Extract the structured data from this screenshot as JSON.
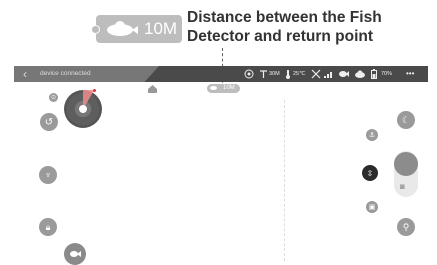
{
  "callout": {
    "badge_value": "10M",
    "text": "Distance between the Fish Detector and return point"
  },
  "topbar": {
    "back_icon": "‹",
    "connection_status": "device connected",
    "depth": "30M",
    "temperature": "25℃",
    "battery": "70%",
    "more": "•••"
  },
  "map": {
    "return_distance": "10M"
  },
  "icons": {
    "gps": "gps-icon",
    "depth": "depth-icon",
    "temp": "thermometer-icon",
    "satellite": "satellite-icon",
    "signal": "signal-icon",
    "fish": "fish-icon",
    "cloud": "cloud-icon",
    "battery": "battery-icon"
  }
}
